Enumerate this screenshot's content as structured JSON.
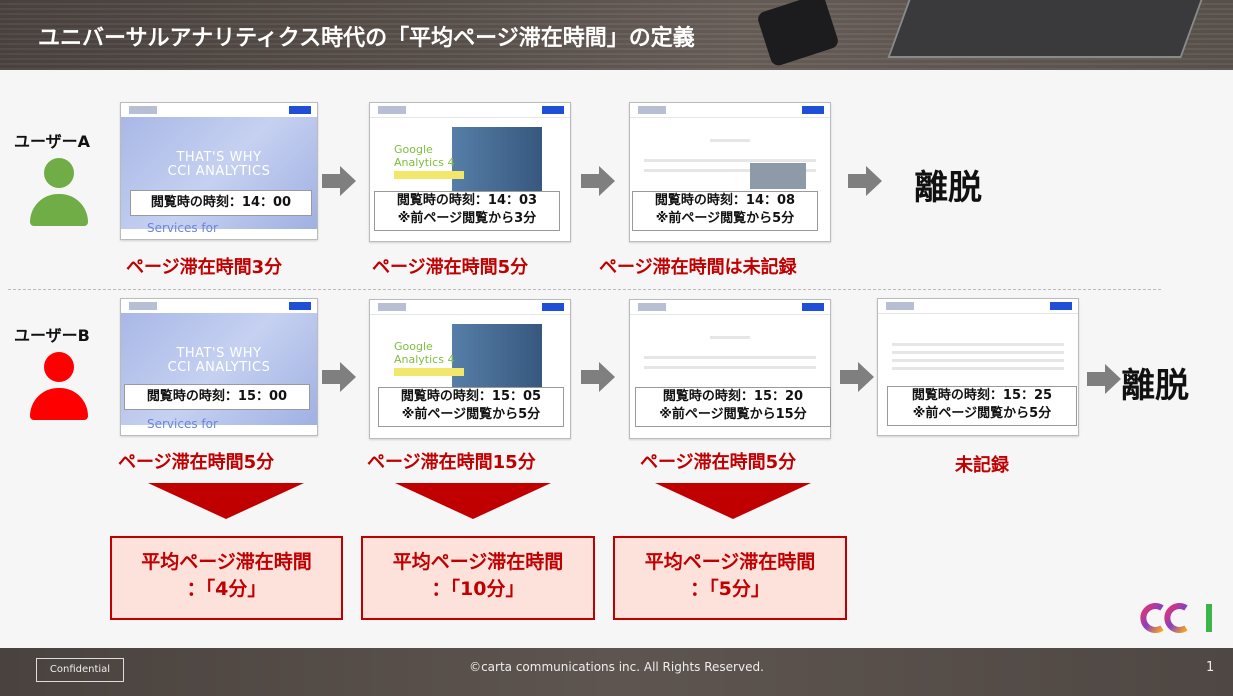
{
  "header": {
    "title": "ユニバーサルアナリティクス時代の「平均ページ滞在時間」の定義"
  },
  "users": [
    {
      "label": "ユーザーA",
      "color": "#70ad47"
    },
    {
      "label": "ユーザーB",
      "color": "#ff0000"
    }
  ],
  "row_a": {
    "captions": [
      {
        "line1": "閲覧時の時刻：14：00"
      },
      {
        "line1": "閲覧時の時刻：14：03",
        "line2": "※前ページ閲覧から3分"
      },
      {
        "line1": "閲覧時の時刻：14：08",
        "line2": "※前ページ閲覧から5分"
      }
    ],
    "labels": [
      "ページ滞在時間3分",
      "ページ滞在時間5分",
      "ページ滞在時間は未記録"
    ],
    "exit": "離脱"
  },
  "row_b": {
    "captions": [
      {
        "line1": "閲覧時の時刻：15：00"
      },
      {
        "line1": "閲覧時の時刻：15：05",
        "line2": "※前ページ閲覧から5分"
      },
      {
        "line1": "閲覧時の時刻：15：20",
        "line2": "※前ページ閲覧から15分"
      },
      {
        "line1": "閲覧時の時刻：15：25",
        "line2": "※前ページ閲覧から5分"
      }
    ],
    "labels": [
      "ページ滞在時間5分",
      "ページ滞在時間15分",
      "ページ滞在時間5分",
      "未記録"
    ],
    "exit": "離脱"
  },
  "shots": {
    "cci_hero": "THAT'S WHY\nCCI ANALYTICS",
    "services": "Services for",
    "ga_text": "Google\nAnalytics 4"
  },
  "averages": [
    {
      "line1": "平均ページ滞在時間",
      "line2": "：「4分」"
    },
    {
      "line1": "平均ページ滞在時間",
      "line2": "：「10分」"
    },
    {
      "line1": "平均ページ滞在時間",
      "line2": "：「5分」"
    }
  ],
  "footer": {
    "confidential": "Confidential",
    "copyright": "©carta communications inc. All Rights Reserved.",
    "page": "1"
  },
  "colors": {
    "accent_red": "#c00000",
    "arrow_gray": "#7f7f7f"
  }
}
